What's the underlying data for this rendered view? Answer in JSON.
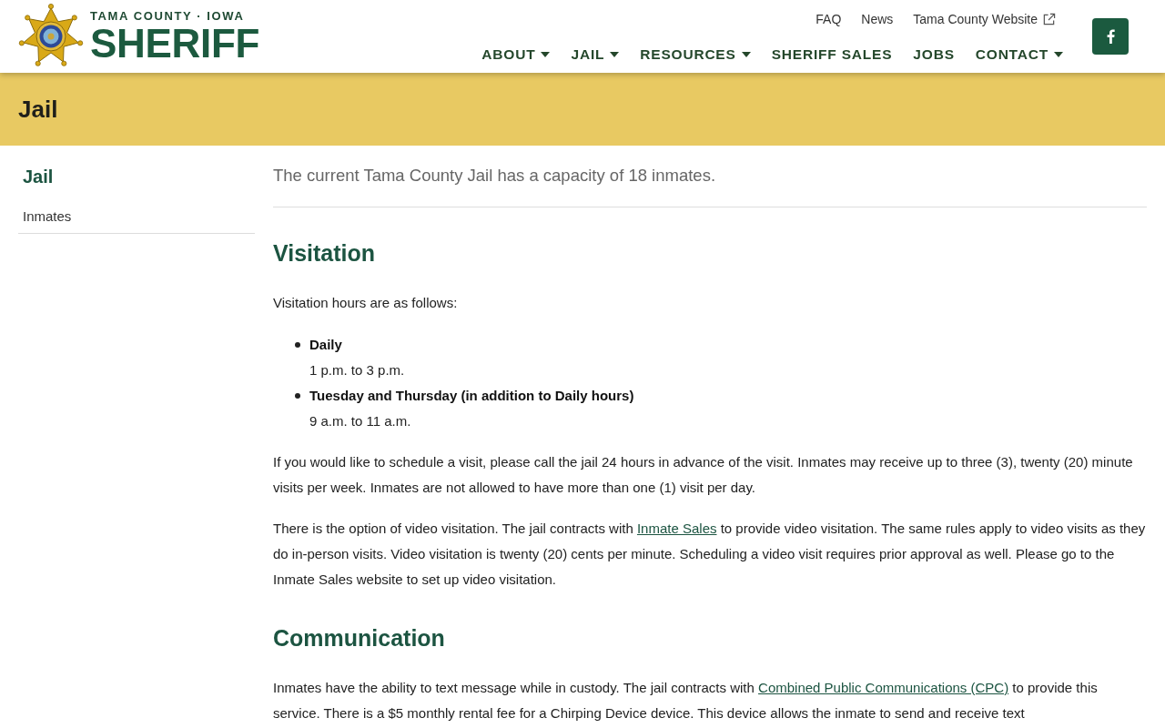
{
  "header": {
    "logo": {
      "subtitle": "TAMA COUNTY · IOWA",
      "title": "SHERIFF"
    },
    "utility_links": [
      {
        "label": "FAQ",
        "external": false
      },
      {
        "label": "News",
        "external": false
      },
      {
        "label": "Tama County Website",
        "external": true
      }
    ],
    "nav": [
      {
        "label": "ABOUT",
        "has_menu": true
      },
      {
        "label": "JAIL",
        "has_menu": true
      },
      {
        "label": "RESOURCES",
        "has_menu": true
      },
      {
        "label": "SHERIFF SALES",
        "has_menu": false
      },
      {
        "label": "JOBS",
        "has_menu": false
      },
      {
        "label": "CONTACT",
        "has_menu": true
      }
    ],
    "social": [
      {
        "kind": "facebook"
      }
    ]
  },
  "page_banner": {
    "title": "Jail"
  },
  "sidebar": {
    "heading": "Jail",
    "items": [
      {
        "label": "Inmates"
      }
    ]
  },
  "content": {
    "intro": "The current Tama County Jail has a capacity of 18 inmates.",
    "blocks": [
      {
        "kind": "heading",
        "text": "Visitation"
      },
      {
        "kind": "paragraph",
        "parts": [
          {
            "kind": "text",
            "text": "Visitation hours are as follows:"
          }
        ]
      },
      {
        "kind": "list",
        "items": [
          {
            "term": "Daily",
            "detail": "1 p.m. to 3 p.m."
          },
          {
            "term": "Tuesday and Thursday (in addition to Daily hours)",
            "detail": "9 a.m. to 11 a.m."
          }
        ]
      },
      {
        "kind": "paragraph",
        "parts": [
          {
            "kind": "text",
            "text": "If you would like to schedule a visit, please call the jail 24 hours in advance of the visit. Inmates may receive up to three (3), twenty (20) minute visits per week. Inmates are not allowed to have more than one (1) visit per day."
          }
        ]
      },
      {
        "kind": "paragraph",
        "parts": [
          {
            "kind": "text",
            "text": "There is the option of video visitation. The jail contracts with "
          },
          {
            "kind": "link",
            "text": "Inmate Sales"
          },
          {
            "kind": "text",
            "text": " to provide video visitation. The same rules apply to video visits as they do in-person visits. Video visitation is twenty (20) cents per minute. Scheduling a video visit requires prior approval as well. Please go to the Inmate Sales website to set up video visitation."
          }
        ]
      },
      {
        "kind": "heading",
        "text": "Communication"
      },
      {
        "kind": "paragraph",
        "parts": [
          {
            "kind": "text",
            "text": "Inmates have the ability to text message while in custody. The jail contracts with "
          },
          {
            "kind": "link",
            "text": "Combined Public Communications (CPC)"
          },
          {
            "kind": "text",
            "text": " to provide this service. There is a $5 monthly rental fee for a Chirping Device device. This device allows the inmate to send and receive text"
          }
        ]
      }
    ]
  }
}
